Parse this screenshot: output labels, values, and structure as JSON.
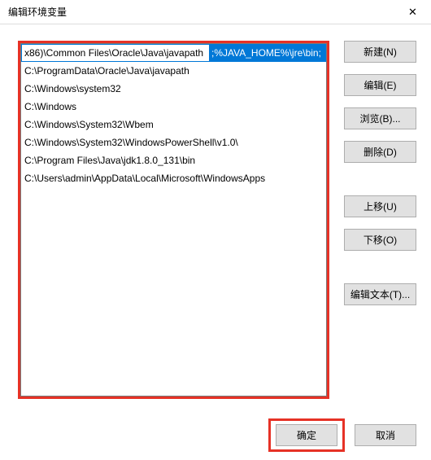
{
  "title": "编辑环境变量",
  "editRow": {
    "plain": "x86)\\Common Files\\Oracle\\Java\\javapath",
    "selected": ";%JAVA_HOME%\\jre\\bin;"
  },
  "rows": [
    "C:\\ProgramData\\Oracle\\Java\\javapath",
    "C:\\Windows\\system32",
    "C:\\Windows",
    "C:\\Windows\\System32\\Wbem",
    "C:\\Windows\\System32\\WindowsPowerShell\\v1.0\\",
    "C:\\Program Files\\Java\\jdk1.8.0_131\\bin",
    "C:\\Users\\admin\\AppData\\Local\\Microsoft\\WindowsApps"
  ],
  "buttons": {
    "new": "新建(N)",
    "edit": "编辑(E)",
    "browse": "浏览(B)...",
    "delete": "删除(D)",
    "moveUp": "上移(U)",
    "moveDown": "下移(O)",
    "editText": "编辑文本(T)..."
  },
  "footer": {
    "ok": "确定",
    "cancel": "取消"
  }
}
